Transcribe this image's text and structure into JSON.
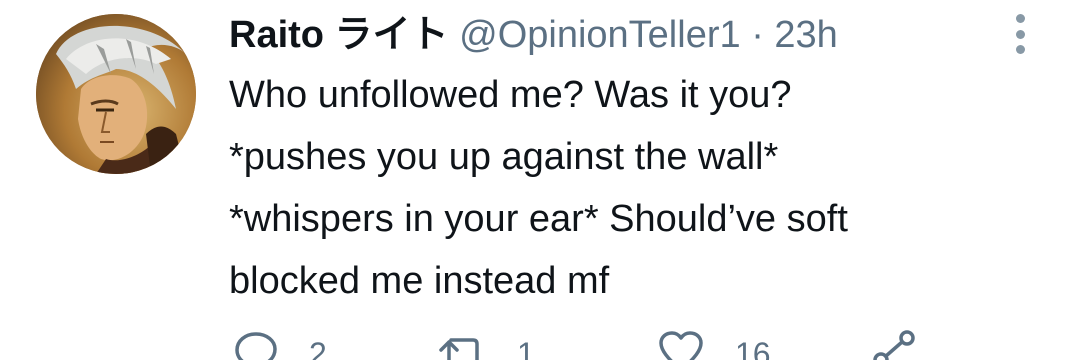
{
  "tweet": {
    "author": {
      "display_name": "Raito ライト",
      "handle": "@OpinionTeller1"
    },
    "separator": "·",
    "time": "23h",
    "text_lines": [
      "Who unfollowed me? Was it you?",
      "*pushes you up against the wall*",
      "*whispers in your ear* Should’ve soft",
      "blocked me instead mf"
    ],
    "actions": {
      "reply_count": "2",
      "retweet_count": "1",
      "like_count": "16"
    }
  },
  "icons": {
    "more": "more-vertical-icon",
    "reply": "reply-icon",
    "retweet": "retweet-icon",
    "like": "heart-icon",
    "share": "share-icon"
  },
  "colors": {
    "text_primary": "#0f1419",
    "text_secondary": "#5b7083",
    "icon_gray": "#8899a6"
  }
}
